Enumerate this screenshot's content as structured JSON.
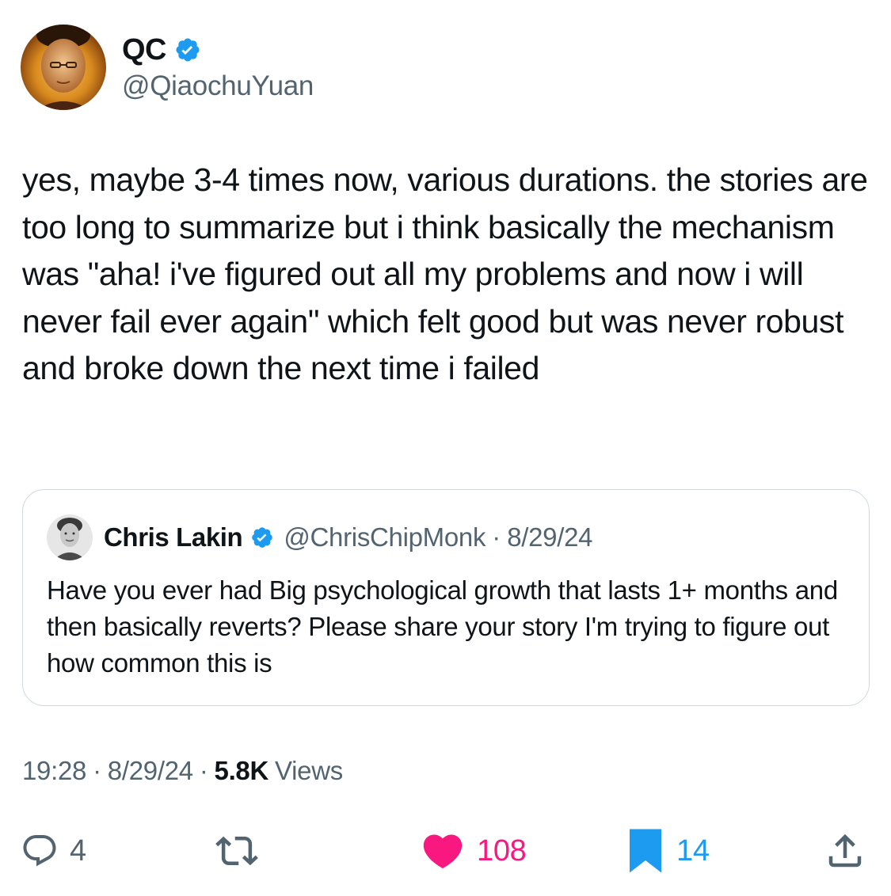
{
  "author": {
    "display_name": "QC",
    "handle": "@QiaochuYuan",
    "verified": true
  },
  "tweet": {
    "text": "yes, maybe 3-4 times now, various durations. the stories are too long to summarize but i think basically the mechanism was \"aha! i've figured out all my problems and now i will never fail ever again\" which felt good but was never robust and broke down the next time i failed"
  },
  "quoted_tweet": {
    "display_name": "Chris Lakin",
    "handle": "@ChrisChipMonk",
    "separator": "·",
    "date": "8/29/24",
    "verified": true,
    "text": "Have you ever had Big psychological growth that lasts 1+ months and then basically reverts? Please share your story I'm trying to figure out how common this is"
  },
  "meta": {
    "time": "19:28",
    "separator": "·",
    "date": "8/29/24",
    "views_count": "5.8K",
    "views_label": "Views"
  },
  "actions": {
    "reply": {
      "icon": "reply-icon",
      "count": "4"
    },
    "retweet": {
      "icon": "retweet-icon"
    },
    "like": {
      "icon": "heart-icon",
      "count": "108",
      "active": true
    },
    "bookmark": {
      "icon": "bookmark-icon",
      "count": "14",
      "active": true
    },
    "share": {
      "icon": "share-icon"
    }
  },
  "colors": {
    "text": "#0f1419",
    "secondary": "#536471",
    "verified": "#1d9bf0",
    "like": "#f91880",
    "bookmark": "#1d9bf0",
    "border": "#cfd9de"
  }
}
